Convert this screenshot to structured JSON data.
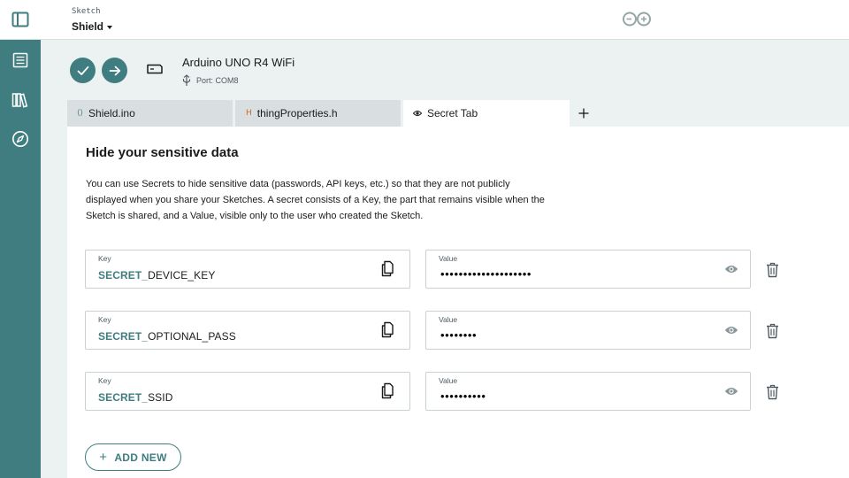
{
  "colors": {
    "accent": "#3f7d80",
    "rail": "#3f7d80",
    "background": "#ecf1f1",
    "tab_inactive": "#d9dfe0"
  },
  "rail": {
    "top_icon": "sidebar-toggle-icon",
    "items": [
      {
        "icon": "sketchbook-list-icon"
      },
      {
        "icon": "libraries-icon"
      },
      {
        "icon": "compass-icon"
      }
    ]
  },
  "header": {
    "label": "Sketch",
    "sketch_name": "Shield",
    "logo": "arduino-logo"
  },
  "toolbar": {
    "verify_icon": "checkmark-icon",
    "upload_icon": "arrow-right-icon",
    "board_icon": "board-icon",
    "board_name": "Arduino UNO R4 WiFi",
    "port_icon": "usb-icon",
    "port": "Port: COM8"
  },
  "tabs": [
    {
      "icon_text": "⟨⟩",
      "label": "Shield.ino"
    },
    {
      "icon_text": "H",
      "label": "thingProperties.h"
    },
    {
      "icon_text": "◉",
      "label": "Secret Tab"
    }
  ],
  "secrets": {
    "title": "Hide your sensitive data",
    "description": "You can use Secrets to hide sensitive data (passwords, API keys, etc.) so that they are not publicly displayed when you share your Sketches. A secret consists of a Key, the part that remains visible when the Sketch is shared, and a Value, visible only to the user who created the Sketch.",
    "key_label": "Key",
    "value_label": "Value",
    "items": [
      {
        "prefix": "SECRET_",
        "key": "DEVICE_KEY",
        "value": "••••••••••••••••••••"
      },
      {
        "prefix": "SECRET_",
        "key": "OPTIONAL_PASS",
        "value": "••••••••"
      },
      {
        "prefix": "SECRET_",
        "key": "SSID",
        "value": "••••••••••"
      }
    ],
    "add_new_label": "ADD NEW"
  }
}
